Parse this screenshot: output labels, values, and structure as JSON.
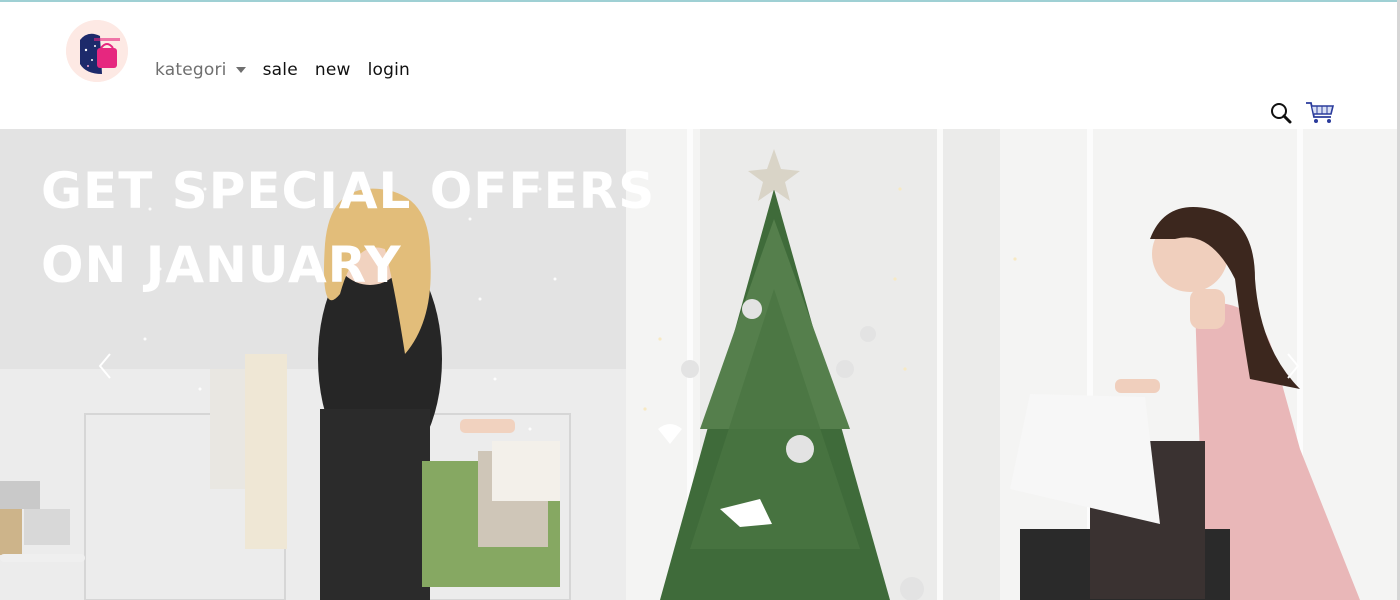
{
  "nav": {
    "kategori": "kategori",
    "sale": "sale",
    "new": "new",
    "login": "login"
  },
  "icons": {
    "logo": "shopping-bag-logo",
    "dropdown": "caret-down-icon",
    "search": "search-icon",
    "cart": "cart-icon",
    "prev": "chevron-left-icon",
    "next": "chevron-right-icon"
  },
  "hero": {
    "title_line1": "GET SPECIAL OFFERS",
    "title_line2": "ON JANUARY"
  },
  "colors": {
    "top_border": "#9fd0d4",
    "nav_text": "#111111",
    "dropdown_text": "#6f6f6f",
    "cart_accent": "#2a3b9c",
    "hero_title": "#ffffff"
  }
}
